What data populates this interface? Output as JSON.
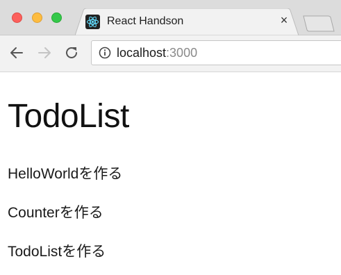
{
  "browser": {
    "tab": {
      "title": "React Handson",
      "close_glyph": "×",
      "favicon": "react-icon"
    },
    "toolbar": {
      "back_icon": "arrow-left-icon",
      "forward_icon": "arrow-right-icon",
      "reload_icon": "reload-icon"
    },
    "address": {
      "host": "localhost",
      "port": ":3000",
      "info_icon": "info-icon"
    }
  },
  "page": {
    "title": "TodoList",
    "todos": [
      "HelloWorldを作る",
      "Counterを作る",
      "TodoListを作る"
    ]
  },
  "colors": {
    "close": "#fc605c",
    "minimize": "#fdbc40",
    "maximize": "#34c84a",
    "react": "#61dafb"
  }
}
